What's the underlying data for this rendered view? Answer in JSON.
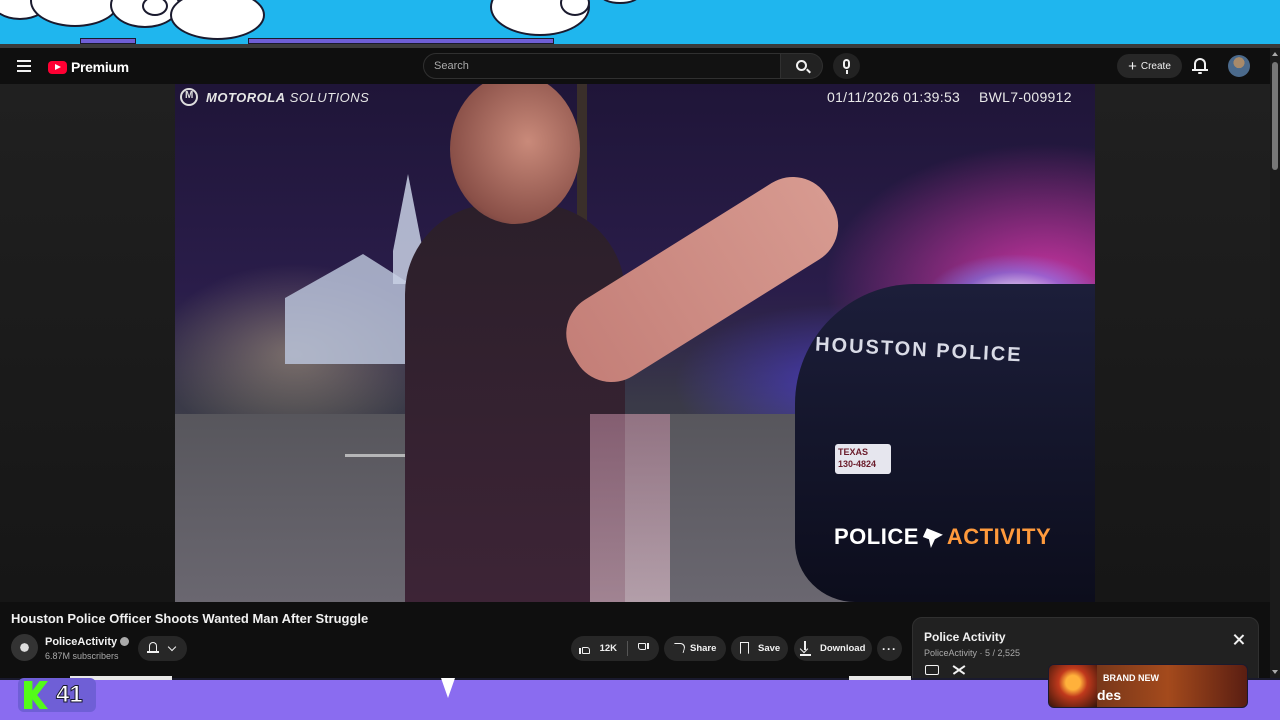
{
  "overlay": {
    "kick_count": "41",
    "ad_badge": "BRAND NEW",
    "ad_text": "des"
  },
  "masthead": {
    "logo_text": "Premium",
    "search_placeholder": "Search",
    "create_label": "Create"
  },
  "video": {
    "overlay_brand_bold": "MOTOROLA",
    "overlay_brand_rest": " SOLUTIONS",
    "overlay_timestamp": "01/11/2026 01:39:53",
    "overlay_id": "BWL7-009912",
    "car_text": "HOUSTON POLICE",
    "plate_text": "TEXAS 130-4824",
    "watermark_left": "POLICE",
    "watermark_right": "ACTIVITY"
  },
  "details": {
    "title": "Houston Police Officer Shoots Wanted Man After Struggle",
    "channel_name": "PoliceActivity",
    "subscribers": "6.87M subscribers",
    "like_count": "12K",
    "share_label": "Share",
    "save_label": "Save",
    "download_label": "Download",
    "more_label": "···"
  },
  "playlist": {
    "title": "Police Activity",
    "subtitle": "PoliceActivity · 5 / 2,525"
  },
  "colors": {
    "youtube_red": "#ff0033",
    "kick_green": "#53fc18",
    "overlay_purple": "#8a6cf0",
    "overlay_sky": "#1fb6ee"
  },
  "icons": [
    "hamburger-icon",
    "search-icon",
    "mic-icon",
    "plus-icon",
    "bell-icon",
    "verified-icon",
    "like-icon",
    "dislike-icon",
    "share-icon",
    "save-icon",
    "download-icon",
    "close-icon",
    "loop-icon",
    "shuffle-icon"
  ]
}
